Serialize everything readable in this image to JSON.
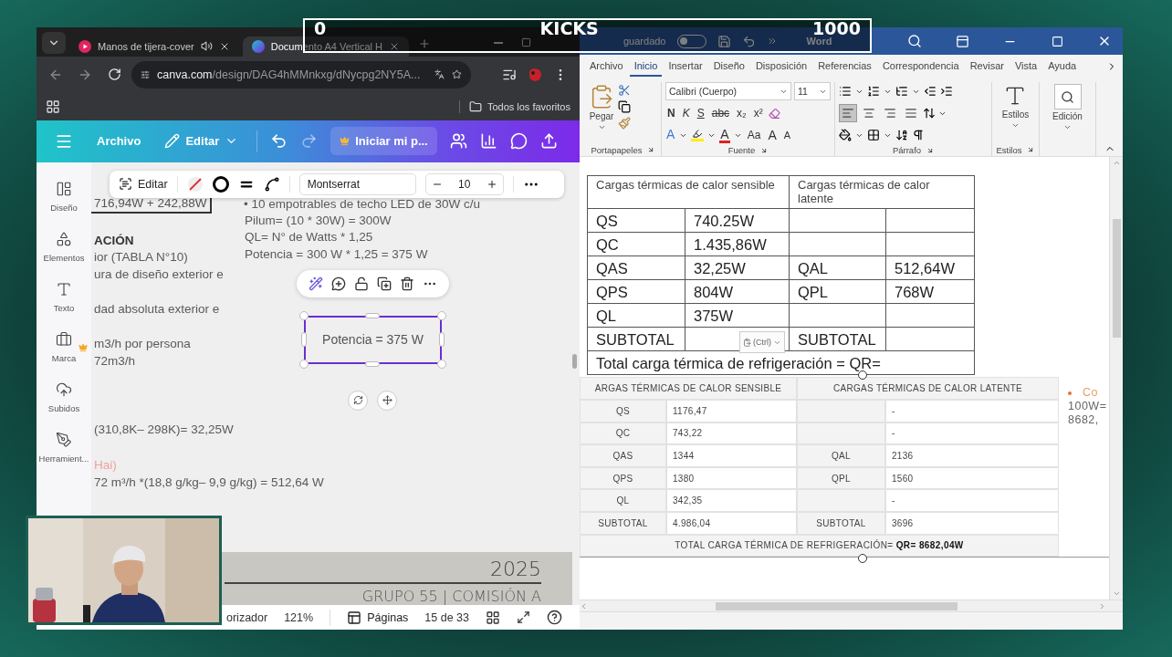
{
  "stream_overlay": {
    "left_count": "0",
    "title": "KICKS",
    "right_count": "1000"
  },
  "browser": {
    "tabs": [
      {
        "title": "Manos de tijera-cover",
        "kind": "video",
        "audio": true,
        "selected": false
      },
      {
        "title": "Documento A4 Vertical H",
        "kind": "design",
        "audio": false,
        "selected": true
      }
    ],
    "address": {
      "host": "canva.com",
      "path": "/design/DAG4hMMnkxg/dNycpg2NY5A..."
    },
    "bookmarks": [
      {
        "label": "Todos los favoritos"
      }
    ]
  },
  "canva": {
    "header": {
      "file_menu": "Archivo",
      "edit_menu": "Editar",
      "upgrade": "Iniciar mi p..."
    },
    "sidebar": [
      {
        "label": "Diseño",
        "kind": "design"
      },
      {
        "label": "Elementos",
        "kind": "elements"
      },
      {
        "label": "Texto",
        "kind": "text"
      },
      {
        "label": "Marca",
        "kind": "brand"
      },
      {
        "label": "Subidos",
        "kind": "uploads"
      },
      {
        "label": "Herramient...",
        "kind": "tools"
      }
    ],
    "toolbar": {
      "edit": "Editar",
      "font": "Montserrat",
      "font_size": "10"
    },
    "canvas_items": [
      {
        "text": "716,94W + 242,88W",
        "kind": "boxed",
        "selected": false
      },
      {
        "text": "• 10 empotrables de techo LED de 30W c/u",
        "kind": "text",
        "selected": false
      },
      {
        "text": "Pilum= (10 * 30W) = 300W",
        "kind": "text",
        "selected": false
      },
      {
        "text": "QL= N° de Watts * 1,25",
        "kind": "text",
        "selected": false
      },
      {
        "text": "Potencia = 300 W * 1,25 = 375 W",
        "kind": "text",
        "selected": false
      },
      {
        "text": "ACIÓN",
        "kind": "heading",
        "selected": false
      },
      {
        "text": "ior (TABLA N°10)",
        "kind": "text",
        "selected": false
      },
      {
        "text": "ura de diseño exterior e",
        "kind": "text",
        "selected": false
      },
      {
        "text": "dad absoluta exterior e",
        "kind": "text",
        "selected": false
      },
      {
        "text": "m3/h por persona",
        "kind": "text",
        "selected": false
      },
      {
        "text": "72m3/h",
        "kind": "text",
        "selected": false
      },
      {
        "text": "(310,8K– 298K)= 32,25W",
        "kind": "text",
        "selected": false
      },
      {
        "text": "Hai)",
        "kind": "accent",
        "selected": false
      },
      {
        "text": "72 m³/h *(18,8 g/kg– 9,9 g/kg) = 512,64 W",
        "kind": "text",
        "selected": false
      },
      {
        "text": "Potencia = 375 W",
        "kind": "text_box",
        "selected": true
      }
    ],
    "footer": {
      "year": "2025",
      "group": "GRUPO 55 | COMISIÓN A"
    },
    "status": {
      "timer": "orizador",
      "zoom": "121%",
      "pages_label": "Páginas",
      "page_count": "15 de 33"
    }
  },
  "word": {
    "autosave": {
      "label": "guardado",
      "on": false
    },
    "title": "Word",
    "tabs": [
      {
        "label": "Archivo",
        "selected": false
      },
      {
        "label": "Inicio",
        "selected": true
      },
      {
        "label": "Insertar",
        "selected": false
      },
      {
        "label": "Diseño",
        "selected": false
      },
      {
        "label": "Disposición",
        "selected": false
      },
      {
        "label": "Referencias",
        "selected": false
      },
      {
        "label": "Correspondencia",
        "selected": false
      },
      {
        "label": "Revisar",
        "selected": false
      },
      {
        "label": "Vista",
        "selected": false
      },
      {
        "label": "Ayuda",
        "selected": false
      }
    ],
    "clipboard": {
      "paste": "Pegar",
      "group": "Portapapeles"
    },
    "font": {
      "name": "Calibri (Cuerpo)",
      "size": "11",
      "format_buttons": [
        "N",
        "K",
        "S",
        "abc",
        "x₂",
        "x²"
      ],
      "effects": "A",
      "font_color": "A",
      "case_button": "Aa",
      "grow": "A",
      "shrink": "A",
      "group": "Fuente"
    },
    "paragraph": {
      "group": "Párrafo",
      "align": [
        {
          "kind": "left",
          "selected": true
        },
        {
          "kind": "center",
          "selected": false
        },
        {
          "kind": "right",
          "selected": false
        },
        {
          "kind": "justify",
          "selected": false
        }
      ]
    },
    "styles": {
      "label": "Estilos",
      "group": "Estilos"
    },
    "editing": {
      "label": "Edición"
    },
    "table": {
      "headers": [
        "Cargas térmicas de calor sensible",
        "Cargas térmicas de calor latente"
      ],
      "rows": [
        {
          "sensible_label": "QS",
          "sensible_value": "740.25W"
        },
        {
          "sensible_label": "QC",
          "sensible_value": "1.435,86W"
        },
        {
          "sensible_label": "QAS",
          "sensible_value": "32,25W",
          "latent_label": "QAL",
          "latent_value": "512,64W"
        },
        {
          "sensible_label": "QPS",
          "sensible_value": "804W",
          "latent_label": "QPL",
          "latent_value": "768W"
        },
        {
          "sensible_label": "QL",
          "sensible_value": "375W"
        },
        {
          "sensible_label": "SUBTOTAL",
          "latent_label": "SUBTOTAL"
        }
      ],
      "total": "Total carga térmica de refrigeración = QR=",
      "paste_options": "(Ctrl)"
    },
    "pasted_table": {
      "headers": [
        "ARGAS TÉRMICAS DE CALOR SENSIBLE",
        "CARGAS TÉRMICAS DE CALOR LATENTE"
      ],
      "rows": [
        {
          "sensible_label": "QS",
          "sensible_value": "1176,47",
          "latent_value": "-"
        },
        {
          "sensible_label": "QC",
          "sensible_value": "743,22",
          "latent_value": "-"
        },
        {
          "sensible_label": "QAS",
          "sensible_value": "1344",
          "latent_label": "QAL",
          "latent_value": "2136"
        },
        {
          "sensible_label": "QPS",
          "sensible_value": "1380",
          "latent_label": "QPL",
          "latent_value": "1560"
        },
        {
          "sensible_label": "QL",
          "sensible_value": "342,35",
          "latent_value": "-"
        },
        {
          "sensible_label": "SUBTOTAL",
          "sensible_value": "4.986,04",
          "latent_label": "SUBTOTAL",
          "latent_value": "3696"
        }
      ],
      "total": "TOTAL CARGA TÉRMICA DE REFRIGERACIÓN= **QR= 8682,04W**",
      "side_lines": [
        "Co",
        "100W=",
        "8682,"
      ]
    }
  }
}
